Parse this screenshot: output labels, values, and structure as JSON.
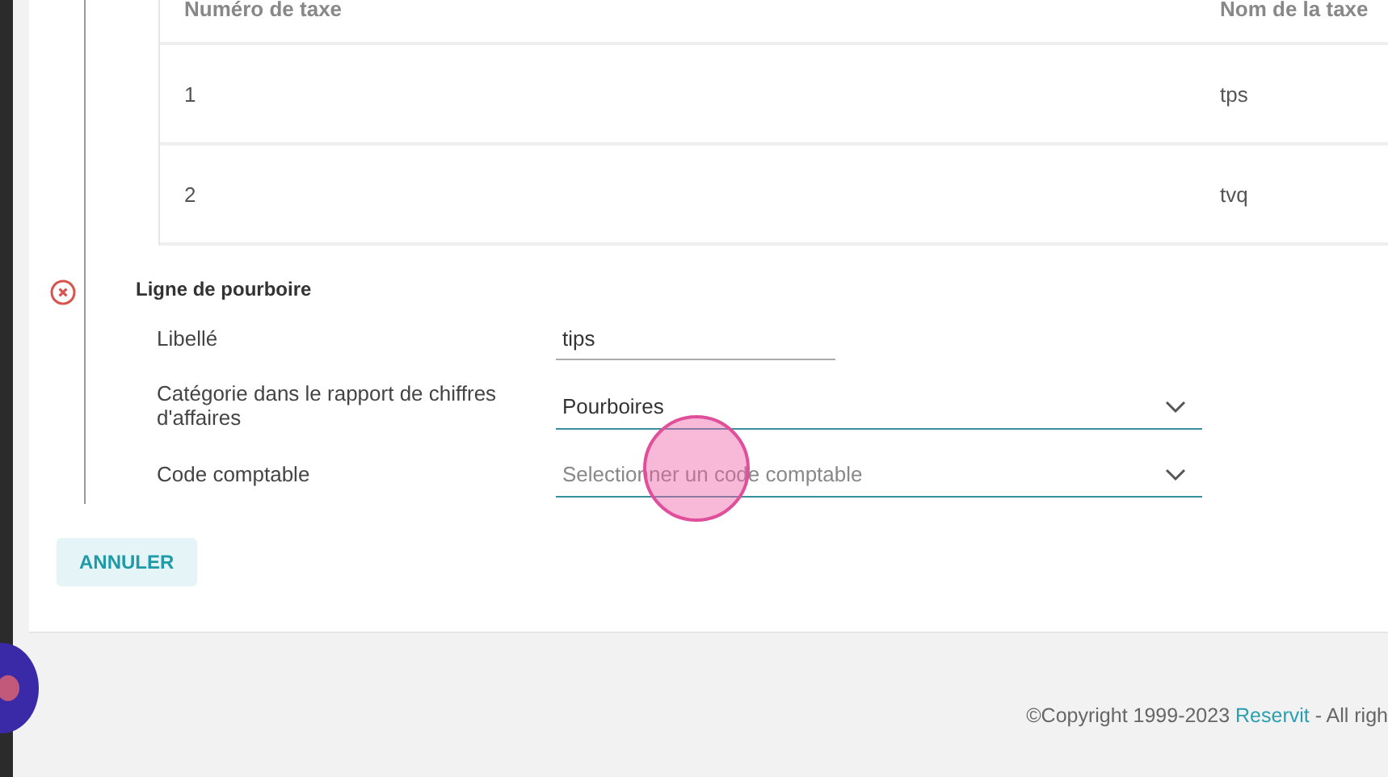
{
  "table": {
    "columns": [
      "Numéro de taxe",
      "Nom de la taxe"
    ],
    "rows": [
      [
        "1",
        "tps"
      ],
      [
        "2",
        "tvq"
      ]
    ]
  },
  "tip_line": {
    "title": "Ligne de pourboire",
    "error": true,
    "fields": [
      {
        "kind": "input",
        "label": "Libellé",
        "value": "tips"
      },
      {
        "kind": "select",
        "label": "Catégorie dans le rapport de chiffres d'affaires",
        "value": "Pourboires"
      },
      {
        "kind": "select",
        "label": "Code comptable",
        "placeholder": "Selectionner un code comptable"
      }
    ]
  },
  "buttons": [
    "ANNULER"
  ],
  "footer": {
    "before": "©Copyright 1999-2023 ",
    "link": "Reservit",
    "after": " - All righ"
  }
}
